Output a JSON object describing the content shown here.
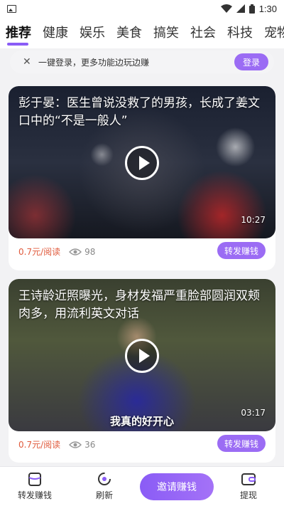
{
  "status_bar": {
    "time": "1:30"
  },
  "tabs": [
    "推荐",
    "健康",
    "娱乐",
    "美食",
    "搞笑",
    "社会",
    "科技",
    "宠物"
  ],
  "login_bar": {
    "text": "一键登录，更多功能边玩边赚",
    "button": "登录"
  },
  "articles": [
    {
      "title": "彭于晏：医生曾说没救了的男孩，长成了姜文口中的“不是一般人”",
      "duration": "10:27",
      "price": "0.7元/阅读",
      "views": "98",
      "share": "转发赚钱"
    },
    {
      "title": "王诗龄近照曝光，身材发福严重脸部圆润双颊肉多，用流利英文对话",
      "caption": "我真的好开心",
      "duration": "03:17",
      "price": "0.7元/阅读",
      "views": "36",
      "share": "转发赚钱"
    }
  ],
  "bottom_nav": {
    "share": "转发赚钱",
    "refresh": "刷新",
    "invite": "邀请赚钱",
    "withdraw": "提现"
  },
  "colors": {
    "accent": "#9b6cf4",
    "price": "#e05a3c"
  }
}
